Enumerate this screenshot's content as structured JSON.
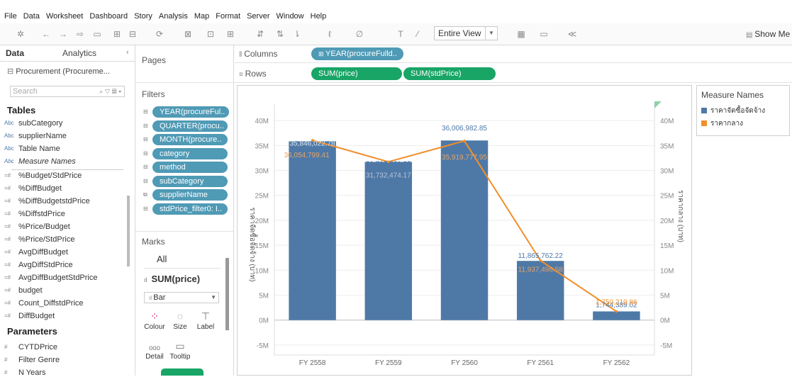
{
  "menu": [
    "File",
    "Data",
    "Worksheet",
    "Dashboard",
    "Story",
    "Analysis",
    "Map",
    "Format",
    "Server",
    "Window",
    "Help"
  ],
  "toolbar": {
    "fit_mode": "Entire View",
    "show_me": "Show Me"
  },
  "left_pane": {
    "tab_data": "Data",
    "tab_analytics": "Analytics",
    "datasource": "Procurement (Procureme...",
    "search_placeholder": "Search",
    "tables_title": "Tables",
    "dimensions": [
      "subCategory",
      "supplierName",
      "Table Name",
      "Measure Names"
    ],
    "measures": [
      "%Budget/StdPrice",
      "%DiffBudget",
      "%DiffBudgetstdPrice",
      "%DiffstdPrice",
      "%Price/Budget",
      "%Price/StdPrice",
      "AvgDiffBudget",
      "AvgDiffStdPrice",
      "AvgDiffBudgetStdPrice",
      "budget",
      "Count_DiffstdPrice",
      "DiffBudget"
    ],
    "parameters_title": "Parameters",
    "parameters": [
      "CYTDPrice",
      "Filter Genre",
      "N Years"
    ]
  },
  "pages_title": "Pages",
  "filters_title": "Filters",
  "filters": [
    "YEAR(procureFul..",
    "QUARTER(procu..",
    "MONTH(procure..",
    "category",
    "method",
    "subCategory",
    "supplierName",
    "stdPrice_filter0: I.."
  ],
  "marks": {
    "title": "Marks",
    "all": "All",
    "sum_label": "SUM(price)",
    "mark_type": "Bar",
    "buttons": [
      "Colour",
      "Size",
      "Label",
      "Detail",
      "Tooltip"
    ]
  },
  "shelves": {
    "columns_label": "Columns",
    "columns_pill": "YEAR(procureFulld..",
    "rows_label": "Rows",
    "rows_pills": [
      "SUM(price)",
      "SUM(stdPrice)"
    ]
  },
  "legend": {
    "title": "Measure Names",
    "items": [
      {
        "label": "ราคาจัดซื้อจัดจ้าง",
        "color": "#4e79a7"
      },
      {
        "label": "ราคากลาง",
        "color": "#f28e2b"
      }
    ]
  },
  "chart_data": {
    "type": "bar",
    "categories": [
      "FY 2558",
      "FY 2559",
      "FY 2560",
      "FY 2561",
      "FY 2562"
    ],
    "series": [
      {
        "name": "ราคาจัดซื้อจัดจ้าง",
        "type": "bar",
        "color": "#4e79a7",
        "values": [
          35846022.78,
          31712861.35,
          36006982.85,
          11865762.22,
          1744389.02
        ],
        "labels": [
          "35,846,022.78",
          "31,712,861.35",
          "36,006,982.85",
          "11,865,762.22",
          "1,744,389.02"
        ]
      },
      {
        "name": "ราคากลาง",
        "type": "line",
        "color": "#f28e2b",
        "values": [
          36054799.41,
          31732474.17,
          35919777.95,
          11937496.58,
          1750210.86
        ],
        "labels": [
          "36,054,799.41",
          "31,732,474.17",
          "35,919,777.95",
          "11,937,496.58",
          "1,750,210.86"
        ]
      }
    ],
    "y_ticks": [
      "40M",
      "35M",
      "30M",
      "25M",
      "20M",
      "15M",
      "10M",
      "5M",
      "0M",
      "-5M"
    ],
    "ylim": [
      -7000000,
      43000000
    ],
    "ylabel_left": "ราคาจัดซื้อจัดจ้าง (บาท)",
    "ylabel_right": "ราคากลาง (บาท)"
  }
}
